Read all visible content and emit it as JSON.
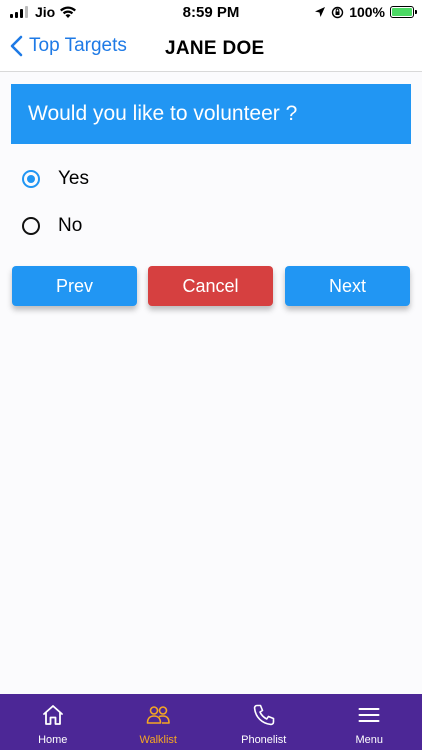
{
  "status_bar": {
    "carrier": "Jio",
    "time": "8:59 PM",
    "battery_percent": "100%",
    "battery_color": "#4cd964"
  },
  "nav": {
    "back_label": "Top Targets",
    "title": "JANE DOE"
  },
  "question": {
    "text": "Would you like to volunteer ?",
    "color": "#2196f3"
  },
  "options": [
    {
      "label": "Yes",
      "selected": true
    },
    {
      "label": "No",
      "selected": false
    }
  ],
  "buttons": {
    "prev": "Prev",
    "cancel": "Cancel",
    "next": "Next"
  },
  "tabbar": {
    "background": "#4c2796",
    "active_color": "#f5a623",
    "items": [
      {
        "label": "Home",
        "icon": "home-icon"
      },
      {
        "label": "Walklist",
        "icon": "users-icon",
        "active": true
      },
      {
        "label": "Phonelist",
        "icon": "phone-icon"
      },
      {
        "label": "Menu",
        "icon": "menu-icon"
      }
    ]
  }
}
